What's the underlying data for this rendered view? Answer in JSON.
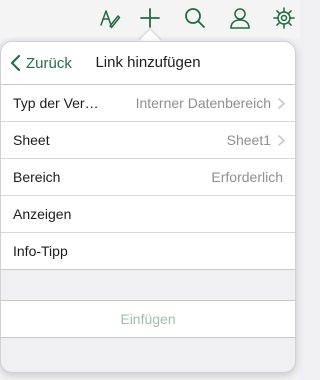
{
  "colors": {
    "accent": "#217346",
    "icon": "#1e6b40",
    "disabled_accent": "#9cc2a8",
    "secondary_text": "#8e8e93",
    "grouped_background": "#efeff4"
  },
  "toolbar": {
    "icons": [
      "draw-pen-icon",
      "add-icon",
      "search-icon",
      "person-icon",
      "gear-icon"
    ]
  },
  "popover": {
    "back_label": "Zurück",
    "title": "Link hinzufügen",
    "rows": [
      {
        "label": "Typ der Ver…",
        "value": "Interner Datenbereich",
        "chevron": true
      },
      {
        "label": "Sheet",
        "value": "Sheet1",
        "chevron": true
      },
      {
        "label": "Bereich",
        "value": "Erforderlich",
        "chevron": false
      },
      {
        "label": "Anzeigen",
        "value": "",
        "chevron": false
      },
      {
        "label": "Info-Tipp",
        "value": "",
        "chevron": false
      }
    ],
    "insert_label": "Einfügen",
    "insert_enabled": false
  }
}
